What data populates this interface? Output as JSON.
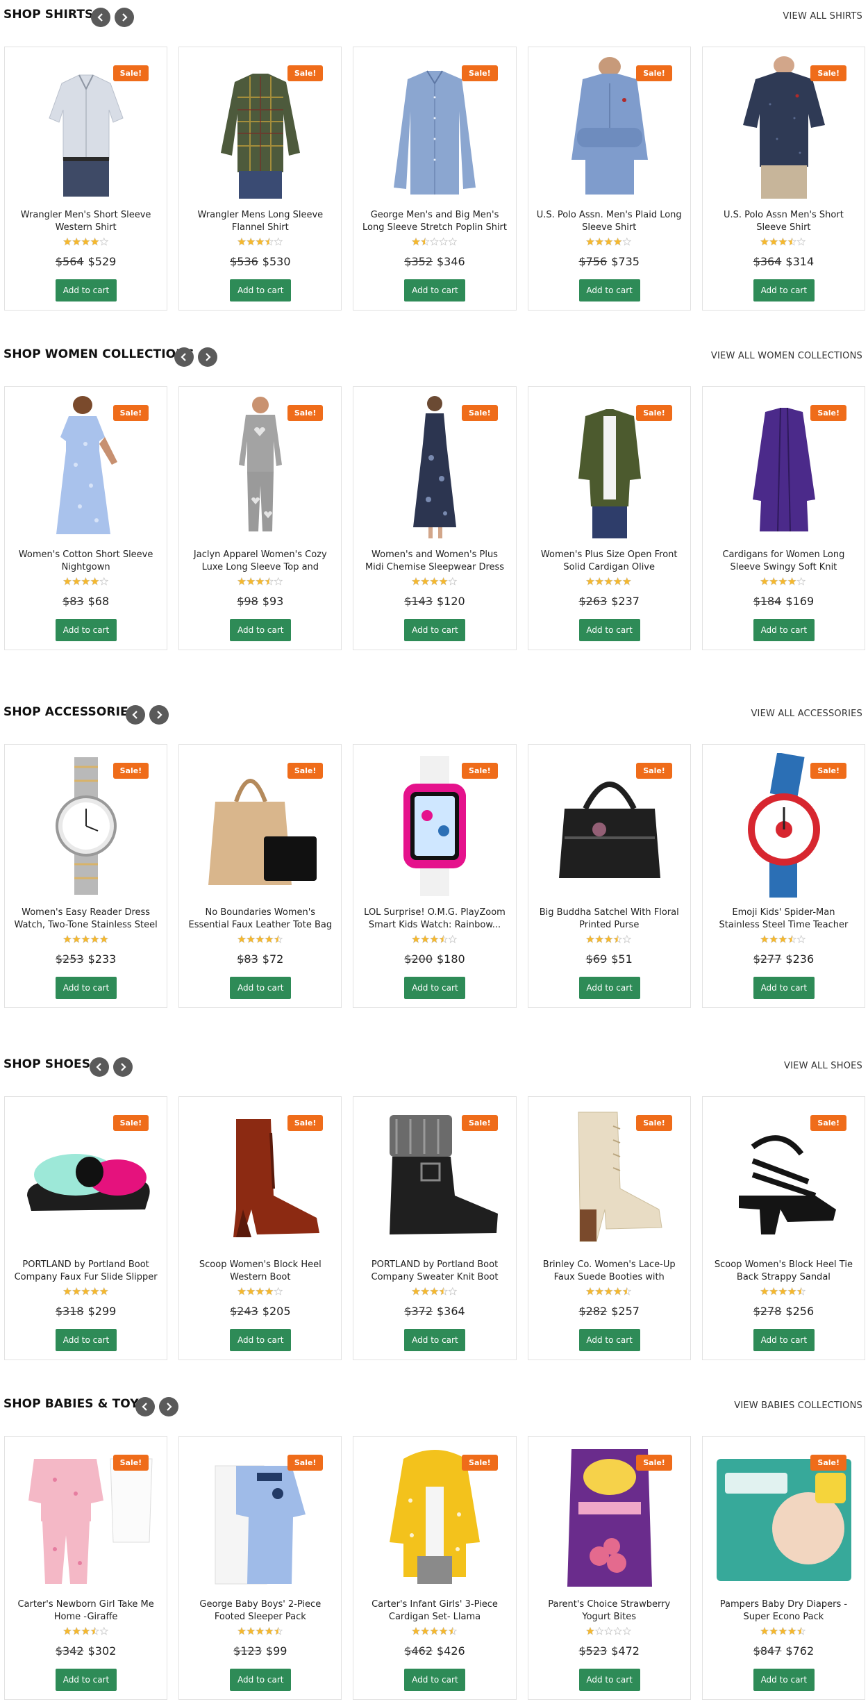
{
  "sections": [
    {
      "title": "SHOP SHIRTS",
      "view_all": "VIEW ALL SHIRTS",
      "products": [
        {
          "name": "Wrangler Men's Short Sleeve Western Shirt",
          "badge": "Sale!",
          "rating": 4.0,
          "old_price": "$564",
          "price": "$529",
          "cart": "Add to cart",
          "image": "shirt-white-plaid",
          "color": "#d8dde6"
        },
        {
          "name": "Wrangler Mens Long Sleeve Flannel Shirt",
          "badge": "Sale!",
          "rating": 3.5,
          "old_price": "$536",
          "price": "$530",
          "cart": "Add to cart",
          "image": "shirt-flannel",
          "color": "#4d5a3c"
        },
        {
          "name": "George Men's and Big Men's Long Sleeve Stretch Poplin Shirt",
          "badge": "Sale!",
          "rating": 1.5,
          "old_price": "$352",
          "price": "$346",
          "cart": "Add to cart",
          "image": "shirt-blue",
          "color": "#8ba6d0"
        },
        {
          "name": "U.S. Polo Assn. Men's Plaid Long Sleeve Shirt",
          "badge": "Sale!",
          "rating": 4.0,
          "old_price": "$756",
          "price": "$735",
          "cart": "Add to cart",
          "image": "shirt-blue-plaid",
          "color": "#7f9ccc"
        },
        {
          "name": "U.S. Polo Assn Men's Short Sleeve Shirt",
          "badge": "Sale!",
          "rating": 3.5,
          "old_price": "$364",
          "price": "$314",
          "cart": "Add to cart",
          "image": "shirt-navy",
          "color": "#2f3a55"
        }
      ]
    },
    {
      "title": "SHOP WOMEN COLLECTIONS",
      "view_all": "VIEW ALL WOMEN COLLECTIONS",
      "products": [
        {
          "name": "Women's Cotton Short Sleeve Nightgown",
          "badge": "Sale!",
          "rating": 4.0,
          "old_price": "$83",
          "price": "$68",
          "cart": "Add to cart",
          "image": "nightgown",
          "color": "#a9c2ec"
        },
        {
          "name": "Jaclyn Apparel Women's Cozy Luxe Long Sleeve Top and Leggings...",
          "badge": "Sale!",
          "rating": 3.5,
          "old_price": "$98",
          "price": "$93",
          "cart": "Add to cart",
          "image": "pajamas-grey",
          "color": "#a3a3a3"
        },
        {
          "name": "Women's and Women's Plus Midi Chemise Sleepwear Dress",
          "badge": "Sale!",
          "rating": 4.0,
          "old_price": "$143",
          "price": "$120",
          "cart": "Add to cart",
          "image": "midi-dress",
          "color": "#2c3550"
        },
        {
          "name": "Women's Plus Size Open Front Solid Cardigan Olive",
          "badge": "Sale!",
          "rating": 5.0,
          "old_price": "$263",
          "price": "$237",
          "cart": "Add to cart",
          "image": "cardigan-olive",
          "color": "#4c5a2e"
        },
        {
          "name": "Cardigans for Women Long Sleeve Swingy Soft Knit Cardigan Sweate...",
          "badge": "Sale!",
          "rating": 4.0,
          "old_price": "$184",
          "price": "$169",
          "cart": "Add to cart",
          "image": "cardigan-purple",
          "color": "#4b2a8a"
        }
      ]
    },
    {
      "title": "SHOP ACCESSORIES",
      "view_all": "VIEW ALL ACCESSORIES",
      "products": [
        {
          "name": "Women's Easy Reader Dress Watch, Two-Tone Stainless Steel Expansio...",
          "badge": "Sale!",
          "rating": 5.0,
          "old_price": "$253",
          "price": "$233",
          "cart": "Add to cart",
          "image": "watch-steel",
          "color": "#b9b9b9"
        },
        {
          "name": "No Boundaries Women's Essential Faux Leather Tote Bag with...",
          "badge": "Sale!",
          "rating": 4.5,
          "old_price": "$83",
          "price": "$72",
          "cart": "Add to cart",
          "image": "tote-bag",
          "color": "#d9b68c"
        },
        {
          "name": "LOL Surprise! O.M.G. PlayZoom Smart Kids Watch: Rainbow...",
          "badge": "Sale!",
          "rating": 3.5,
          "old_price": "$200",
          "price": "$180",
          "cart": "Add to cart",
          "image": "kids-watch",
          "color": "#e5128c"
        },
        {
          "name": "Big Buddha Satchel With Floral Printed Purse",
          "badge": "Sale!",
          "rating": 3.5,
          "old_price": "$69",
          "price": "$51",
          "cart": "Add to cart",
          "image": "satchel",
          "color": "#1f1f1f"
        },
        {
          "name": "Emoji Kids' Spider-Man Stainless Steel Time Teacher Watch, Red...",
          "badge": "Sale!",
          "rating": 3.5,
          "old_price": "$277",
          "price": "$236",
          "cart": "Add to cart",
          "image": "spider-watch",
          "color": "#2b6fb5"
        }
      ]
    },
    {
      "title": "SHOP SHOES",
      "view_all": "VIEW ALL SHOES",
      "products": [
        {
          "name": "PORTLAND by Portland Boot Company Faux Fur Slide Slipper",
          "badge": "Sale!",
          "rating": 5.0,
          "old_price": "$318",
          "price": "$299",
          "cart": "Add to cart",
          "image": "fur-slipper",
          "color": "#e5127d"
        },
        {
          "name": "Scoop Women's Block Heel Western Boot",
          "badge": "Sale!",
          "rating": 4.0,
          "old_price": "$243",
          "price": "$205",
          "cart": "Add to cart",
          "image": "western-boot",
          "color": "#8c2a12"
        },
        {
          "name": "PORTLAND by Portland Boot Company Sweater Knit Boot",
          "badge": "Sale!",
          "rating": 3.5,
          "old_price": "$372",
          "price": "$364",
          "cart": "Add to cart",
          "image": "knit-boot",
          "color": "#1f1f1f"
        },
        {
          "name": "Brinley Co. Women's Lace-Up Faux Suede Booties with Stacked Heel",
          "badge": "Sale!",
          "rating": 4.5,
          "old_price": "$282",
          "price": "$257",
          "cart": "Add to cart",
          "image": "lace-bootie",
          "color": "#e8dcc4"
        },
        {
          "name": "Scoop Women's Block Heel Tie Back Strappy Sandal",
          "badge": "Sale!",
          "rating": 4.5,
          "old_price": "$278",
          "price": "$256",
          "cart": "Add to cart",
          "image": "strappy-sandal",
          "color": "#141414"
        }
      ]
    },
    {
      "title": "SHOP BABIES & TOYS",
      "view_all": "VIEW BABIES COLLECTIONS",
      "products": [
        {
          "name": "Carter's Newborn Girl Take Me Home -Giraffe",
          "badge": "Sale!",
          "rating": 3.5,
          "old_price": "$342",
          "price": "$302",
          "cart": "Add to cart",
          "image": "baby-set-pink",
          "color": "#f4b8c6"
        },
        {
          "name": "George Baby Boys' 2-Piece Footed Sleeper Pack",
          "badge": "Sale!",
          "rating": 4.5,
          "old_price": "$123",
          "price": "$99",
          "cart": "Add to cart",
          "image": "baby-sleeper",
          "color": "#9fbbe8"
        },
        {
          "name": "Carter's Infant Girls' 3-Piece Cardigan Set- Llama",
          "badge": "Sale!",
          "rating": 4.5,
          "old_price": "$462",
          "price": "$426",
          "cart": "Add to cart",
          "image": "baby-cardigan",
          "color": "#f3c21c"
        },
        {
          "name": "Parent's Choice Strawberry Yogurt Bites",
          "badge": "Sale!",
          "rating": 1.0,
          "old_price": "$523",
          "price": "$472",
          "cart": "Add to cart",
          "image": "yogurt-bites",
          "color": "#6a2c8c"
        },
        {
          "name": "Pampers Baby Dry Diapers - Super Econo Pack",
          "badge": "Sale!",
          "rating": 4.5,
          "old_price": "$847",
          "price": "$762",
          "cart": "Add to cart",
          "image": "diapers",
          "color": "#37a99a"
        }
      ]
    }
  ],
  "icons": {
    "prev": "chevron-left-icon",
    "next": "chevron-right-icon",
    "star": "star-icon"
  },
  "colors": {
    "badge": "#ef6c1a",
    "cart_button": "#2e8b57",
    "star": "#f5b82e",
    "arrow": "#5a5a5a"
  }
}
